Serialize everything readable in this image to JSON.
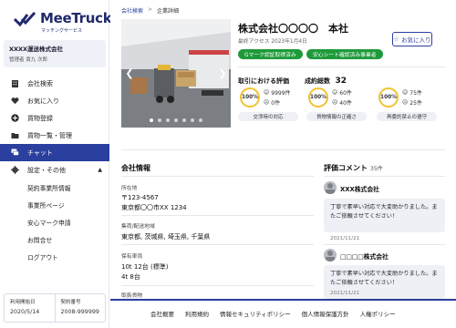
{
  "sidebar": {
    "logo": {
      "name": "MeeTruck",
      "tagline": "マッチングサービス"
    },
    "account": {
      "company": "XXXX運送株式会社",
      "user": "管理者  責九  次郎"
    },
    "nav": [
      {
        "label": "会社検索",
        "icon": "building-icon"
      },
      {
        "label": "お気に入り",
        "icon": "heart-icon"
      },
      {
        "label": "貨物登録",
        "icon": "plus-circle-icon"
      },
      {
        "label": "貨物一覧・管理",
        "icon": "folder-icon"
      },
      {
        "label": "チャット",
        "icon": "chat-icon",
        "active": true
      },
      {
        "label": "設定・その他",
        "icon": "gear-icon"
      }
    ],
    "sub": [
      "契約事業所情報",
      "事業所ページ",
      "安心マーク申請",
      "お問合せ",
      "ログアウト"
    ],
    "footer": {
      "start_label": "利用開始日",
      "start_value": "2020/5/14",
      "contract_label": "契約番号",
      "contract_value": "2008-999999"
    }
  },
  "breadcrumb": {
    "root": "会社検索",
    "sep": ">",
    "current": "企業詳細"
  },
  "company": {
    "name": "株式会社〇〇〇〇　本社",
    "last_access": "最終アクセス 2023年1月4日",
    "fav_label": "お気に入り",
    "badges": [
      "Gマーク認証取得済み",
      "安心シート確認済み事業者"
    ]
  },
  "evaluation": {
    "title": "取引における評価",
    "deals_label": "成約総数",
    "deals_count": "32",
    "metrics": [
      {
        "percent": "100%",
        "good": "9999件",
        "bad": "0件",
        "label": "交渉時の対応"
      },
      {
        "percent": "100%",
        "good": "60件",
        "bad": "40件",
        "label": "貨物情報の正確さ"
      },
      {
        "percent": "100%",
        "good": "75件",
        "bad": "25件",
        "label": "再委託禁止の遵守"
      }
    ]
  },
  "info": {
    "heading": "会社情報",
    "address_label": "所在地",
    "postal": "〒123-4567",
    "address": "東京都〇〇市XX 1234",
    "area_label": "集荷/配送地域",
    "area": "東京都, 茨城県, 埼玉県, 千葉県",
    "vehicles_label": "保有車両",
    "vehicles_1": "10t 12台 (標準)",
    "vehicles_2": "4t 8台",
    "cargo_label": "取扱貨物"
  },
  "reviews": {
    "heading": "評価コメント",
    "count": "35件",
    "items": [
      {
        "name": "XXX株式会社",
        "text": "丁寧で素早い対応で大変助かりました。またご依頼させてください！",
        "date": "2021/11/21"
      },
      {
        "name": "□□□□株式会社",
        "text": "丁寧で素早い対応で大変助かりました。またご依頼させてください！",
        "date": "2021/11/21"
      }
    ]
  },
  "footer_links": [
    "会社概要",
    "利用規約",
    "情報セキュリティポリシー",
    "個人情報保護方針",
    "人権ポリシー"
  ]
}
